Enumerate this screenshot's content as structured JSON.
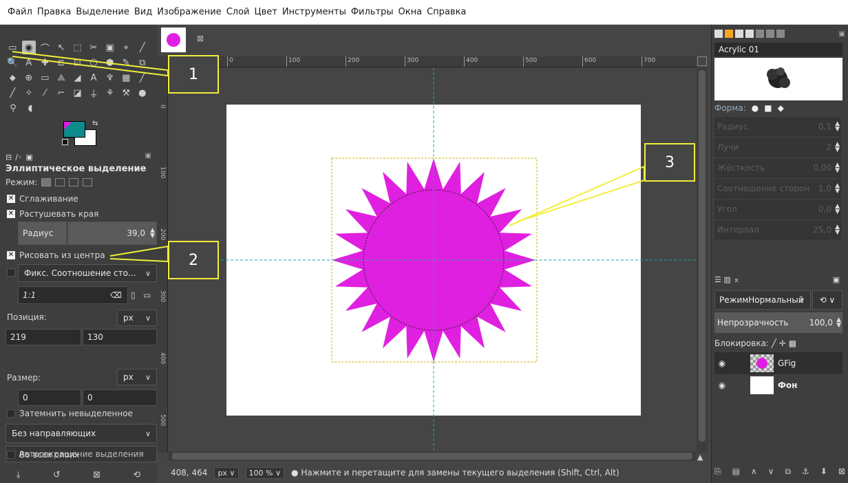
{
  "menubar": [
    "Файл",
    "Правка",
    "Выделение",
    "Вид",
    "Изображение",
    "Слой",
    "Цвет",
    "Инструменты",
    "Фильтры",
    "Окна",
    "Справка"
  ],
  "toolbox": {
    "rows": [
      [
        "▭",
        "◉",
        "⌒",
        "↖",
        "⬚",
        "✂",
        "▣",
        "⌖",
        "╱"
      ],
      [
        "🔍",
        "A",
        "✚",
        "⊏",
        "⊡",
        "⬡",
        "⬢",
        "✎",
        "⧉"
      ],
      [
        "⬥",
        "⊕",
        "▭",
        "⟁",
        "◢",
        "A",
        "♆",
        "▦",
        "╱"
      ],
      [
        "╱",
        "✧",
        "⁄",
        "⌐",
        "◪",
        "⏚",
        "⚘",
        "⚒",
        "●"
      ],
      [
        "⚲",
        "◖"
      ]
    ]
  },
  "tool_options": {
    "title": "Эллиптическое выделение",
    "mode_label": "Режим:",
    "antialias": "Сглаживание",
    "feather": "Растушевать края",
    "radius_label": "Радиус",
    "radius_value": "39,0",
    "from_center": "Рисовать из центра",
    "fixed": "Фикс. Соотношение сто...",
    "ratio_value": "1:1",
    "position_label": "Позиция:",
    "position_unit": "px",
    "pos_x": "219",
    "pos_y": "130",
    "size_label": "Размер:",
    "size_unit": "px",
    "size_w": "0",
    "size_h": "0",
    "highlight": "Затемнить невыделенное",
    "guides": "Без направляющих",
    "autoshrink": "Автосокращение выделения",
    "all_layers": "Во всех слоях"
  },
  "ruler": {
    "h_marks": [
      "0",
      "100",
      "200",
      "300",
      "400",
      "500",
      "600",
      "700"
    ],
    "v_marks": [
      "0",
      "100",
      "200",
      "300",
      "400",
      "500"
    ]
  },
  "statusbar": {
    "coords": "408, 464",
    "unit": "px",
    "zoom": "100 %",
    "message": "Нажмите и перетащите для замены текущего выделения (Shift, Ctrl, Alt)"
  },
  "brushes": {
    "name": "Acrylic 01",
    "shape_label": "Форма:",
    "rows": [
      {
        "label": "Радиус",
        "value": "0,1"
      },
      {
        "label": "Лучи",
        "value": "2"
      },
      {
        "label": "Жёсткость",
        "value": "0,00"
      },
      {
        "label": "Соотношение сторон",
        "value": "1,0"
      },
      {
        "label": "Угол",
        "value": "0,0"
      },
      {
        "label": "Интервал",
        "value": "25,0"
      }
    ]
  },
  "layers": {
    "mode_label": "Режим",
    "mode_value": "Нормальный",
    "opacity_label": "Непрозрачность",
    "opacity_value": "100,0",
    "lock_label": "Блокировка:",
    "items": [
      {
        "name": "GFig"
      },
      {
        "name": "Фон"
      }
    ]
  },
  "callouts": [
    "1",
    "2",
    "3"
  ],
  "colors": {
    "accent": "#e020e0",
    "guide": "#1aa7a7",
    "callout": "#f2ee3a"
  }
}
